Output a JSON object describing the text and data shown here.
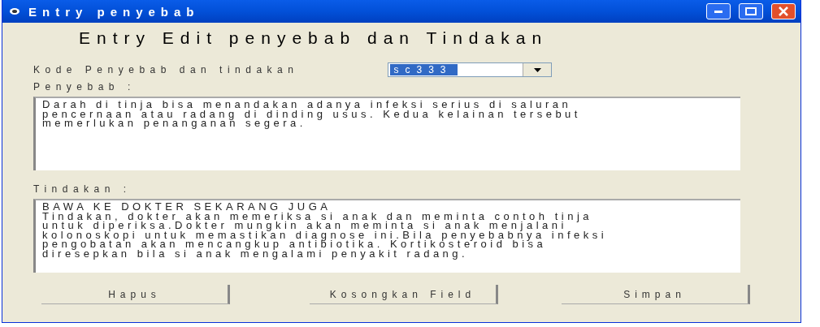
{
  "window": {
    "title": "Entry penyebab"
  },
  "heading": "Entry Edit penyebab dan Tindakan",
  "code_field": {
    "label": "Kode Penyebab dan tindakan",
    "value": "sc333"
  },
  "cause": {
    "label": "Penyebab :",
    "lines": [
      "Darah di tinja bisa menandakan adanya infeksi serius di saluran",
      "pencernaan atau radang di dinding usus. Kedua kelainan tersebut",
      "memerlukan penanganan segera."
    ]
  },
  "action": {
    "label": "Tindakan :",
    "lines": [
      "BAWA KE DOKTER SEKARANG JUGA",
      "Tindakan, dokter akan memeriksa si anak dan meminta contoh tinja",
      "untuk diperiksa.Dokter mungkin akan meminta si anak menjalani",
      "kolonoskopi untuk memastikan diagnose ini.Bila penyebabnya infeksi",
      "pengobatan akan mencangkup antibiotika. Kortikosteroid bisa",
      "diresepkan bila si anak mengalami penyakit radang."
    ]
  },
  "buttons": [
    "Hapus",
    "Kosongkan Field",
    "Simpan"
  ]
}
